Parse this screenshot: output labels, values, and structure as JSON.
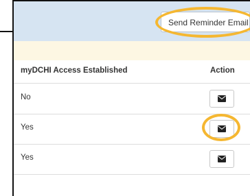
{
  "toolbar": {
    "reminder_label": "Send Reminder Email"
  },
  "table": {
    "headers": {
      "access": "myDCHI Access Established",
      "action": "Action"
    },
    "rows": [
      {
        "access": "No"
      },
      {
        "access": "Yes"
      },
      {
        "access": "Yes"
      }
    ]
  },
  "colors": {
    "highlight": "#f5b731",
    "header_bar": "#d6e4f2",
    "notice_bar": "#fdf7e3"
  },
  "icons": {
    "row_action": "envelope-icon"
  }
}
